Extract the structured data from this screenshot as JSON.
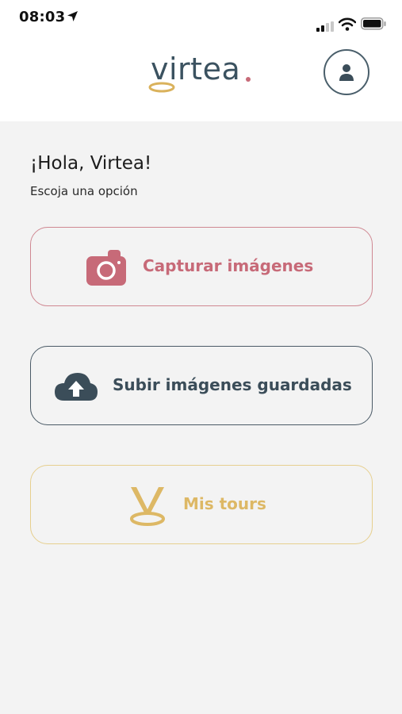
{
  "status_bar": {
    "time": "08:03"
  },
  "header": {
    "logo_text": "virtea",
    "profile_icon": "user-icon"
  },
  "greeting": {
    "title": "¡Hola, Virtea!",
    "subtitle": "Escoja una opción"
  },
  "options": [
    {
      "label": "Capturar imágenes",
      "icon": "camera-icon",
      "color": "#c76a78"
    },
    {
      "label": "Subir imágenes guardadas",
      "icon": "cloud-upload-icon",
      "color": "#3b4d59"
    },
    {
      "label": "Mis tours",
      "icon": "virtea-v-icon",
      "color": "#ddb865"
    }
  ],
  "colors": {
    "brand_dark": "#3b5260",
    "brand_accent": "#c76a78",
    "brand_gold": "#ddb865",
    "background": "#f3f3f3"
  }
}
